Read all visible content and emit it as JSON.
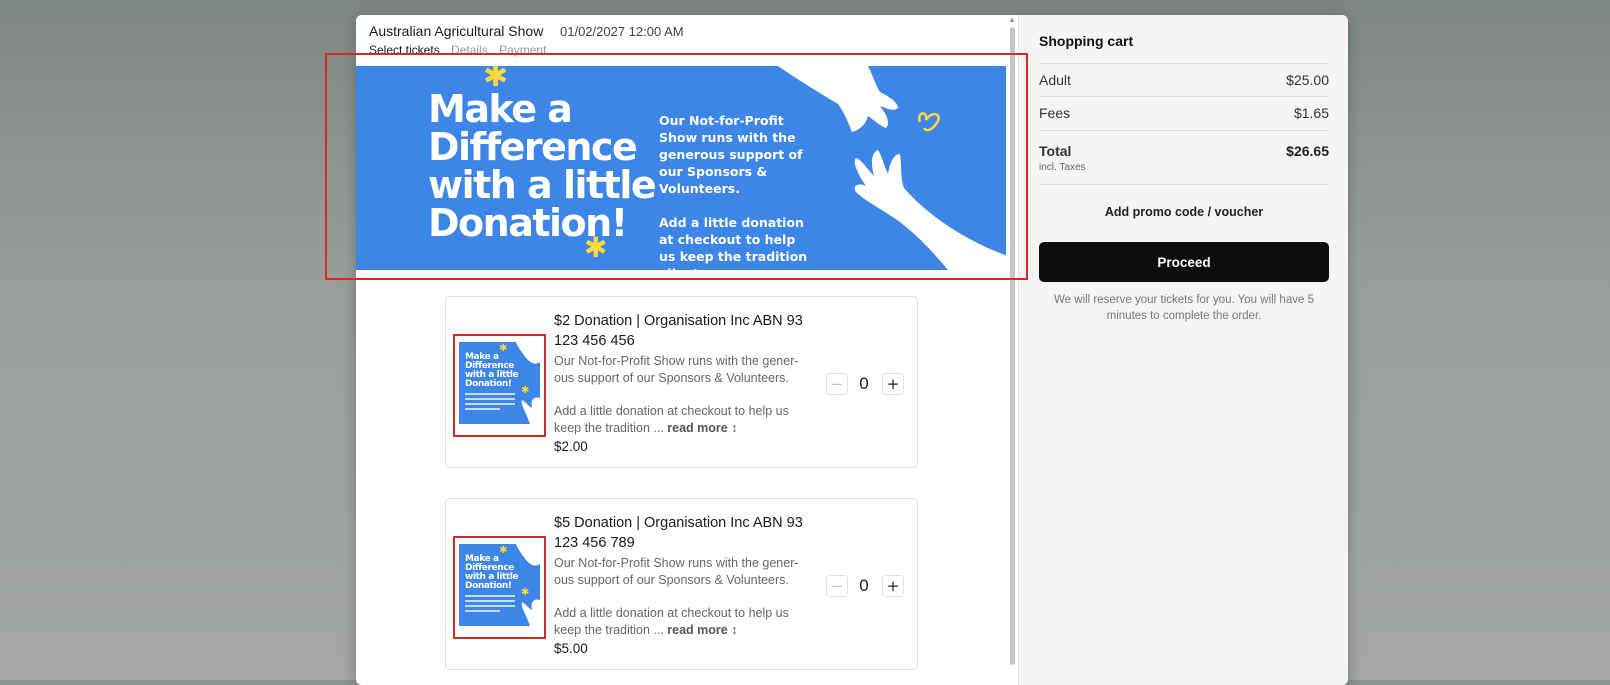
{
  "event": {
    "title": "Australian Agricultural Show",
    "date": "01/02/2027 12:00 AM",
    "steps": [
      "Select tickets",
      "Details",
      "Payment"
    ]
  },
  "banner": {
    "headline": "Make a Difference with a little Donation!",
    "text_1": "Our Not-for-Profit Show runs with the generous support of our Sponsors & Volunteers.",
    "text_2": "Add a little donation at checkout to help us keep the tradition alive!"
  },
  "tickets": [
    {
      "title": "$2 Donation | Organisation Inc ABN 93 123 456 456",
      "desc_1": "Our Not-for-Profit Show runs with the gener-ous support of our Sponsors & Volunteers.",
      "desc_2": "Add a little donation at checkout to help us keep the tradition ...",
      "read_more": "read more ↕",
      "price": "$2.00",
      "qty": "0"
    },
    {
      "title": "$5 Donation | Organisation Inc ABN 93 123 456 789",
      "desc_1": "Our Not-for-Profit Show runs with the gener-ous support of our Sponsors & Volunteers.",
      "desc_2": "Add a little donation at checkout to help us keep the tradition ...",
      "read_more": "read more ↕",
      "price": "$5.00",
      "qty": "0"
    }
  ],
  "thumb_headline": "Make a Difference with a little Donation!",
  "cart": {
    "title": "Shopping cart",
    "lines": [
      {
        "label": "Adult",
        "amount": "$25.00"
      },
      {
        "label": "Fees",
        "amount": "$1.65"
      }
    ],
    "total_label": "Total",
    "total_sub": "incl. Taxes",
    "total_amount": "$26.65",
    "promo_label": "Add promo code / voucher",
    "proceed_label": "Proceed",
    "reserve_note": "We will reserve your tickets for you. You will have 5 minutes to complete the order."
  },
  "icons": {
    "minus": "minus-icon",
    "plus": "plus-icon",
    "star": "star-burst-icon",
    "hands": "reaching-hands-illustration",
    "scroll_up": "scroll-up-arrow-icon"
  },
  "colors": {
    "banner_blue": "#3d85e6",
    "accent_yellow": "#ffd83a",
    "proceed_bg": "#0d0d0d",
    "highlight_red": "#d42a2a"
  }
}
